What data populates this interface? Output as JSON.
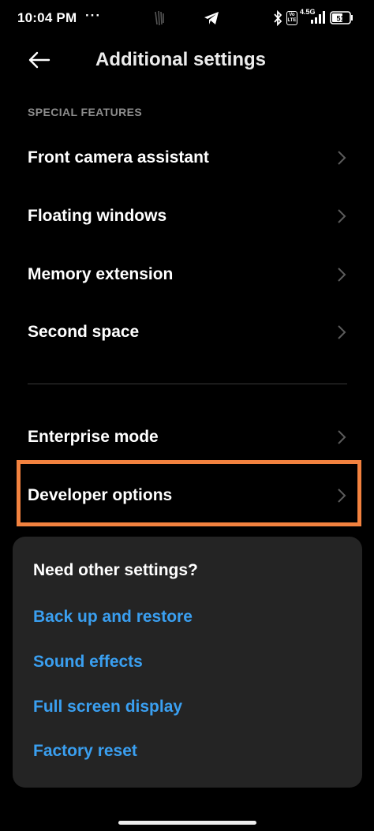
{
  "status_bar": {
    "time": "10:04 PM",
    "more": "···",
    "volte": "Vo LTE",
    "network": "4.5G",
    "battery_level": "51",
    "icons": [
      "telegram-icon",
      "bluetooth-icon",
      "volte-icon",
      "signal-icon",
      "battery-icon"
    ]
  },
  "header": {
    "title": "Additional settings",
    "back_icon": "back-arrow-icon"
  },
  "section": {
    "label": "SPECIAL FEATURES"
  },
  "menu": {
    "items": [
      {
        "label": "Front camera assistant"
      },
      {
        "label": "Floating windows"
      },
      {
        "label": "Memory extension"
      },
      {
        "label": "Second space"
      },
      {
        "label": "Enterprise mode"
      },
      {
        "label": "Developer options"
      }
    ]
  },
  "suggestions": {
    "title": "Need other settings?",
    "links": [
      "Back up and restore",
      "Sound effects",
      "Full screen display",
      "Factory reset"
    ]
  },
  "colors": {
    "background": "#000000",
    "card": "#242424",
    "link": "#3a9ff0",
    "highlight": "#f2823f",
    "section_text": "#8d8d8d"
  }
}
